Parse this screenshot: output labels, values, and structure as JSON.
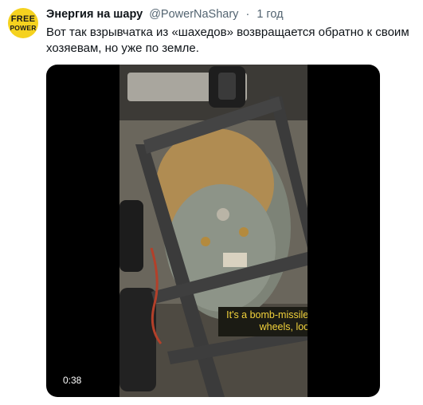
{
  "account": {
    "avatar_line1": "FREE",
    "avatar_line2": "POWER",
    "name": "Энергия на шару",
    "handle": "@PowerNaShary",
    "separator": "·",
    "time": "1 год"
  },
  "tweet": {
    "text": "Вот так взрывчатка из «шахедов» возвращается обратно к своим хозяевам, но уже по земле."
  },
  "media": {
    "subtitle": "It's a bomb-missile, f*ck, on wheels, look",
    "duration": "0:38"
  },
  "colors": {
    "avatar": "#f5d21f",
    "subtitle_text": "#f2d23b",
    "handle": "#536471"
  }
}
